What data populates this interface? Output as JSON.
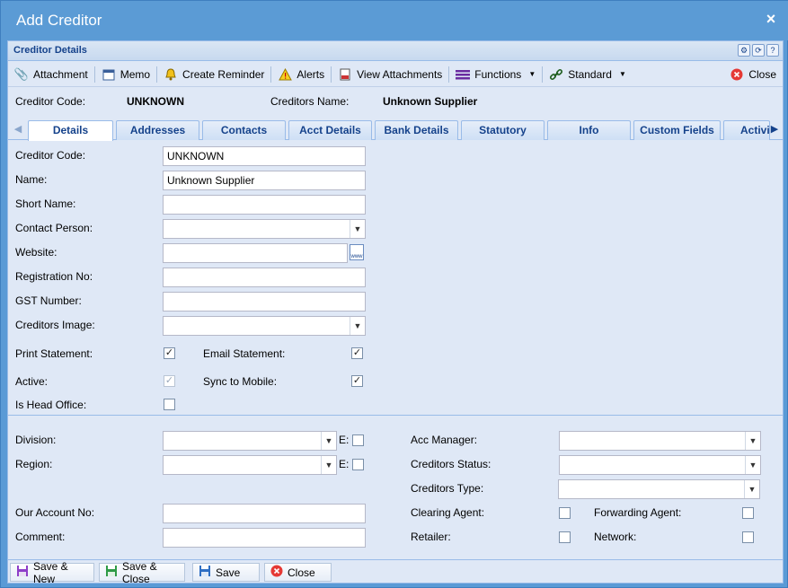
{
  "window": {
    "title": "Add Creditor",
    "close_glyph": "×"
  },
  "panel": {
    "title": "Creditor Details"
  },
  "toolbar": {
    "attachment": "Attachment",
    "memo": "Memo",
    "create_reminder": "Create Reminder",
    "alerts": "Alerts",
    "view_attachments": "View Attachments",
    "functions": "Functions",
    "standard": "Standard",
    "close": "Close"
  },
  "header_info": {
    "code_label": "Creditor Code:",
    "code_value": "UNKNOWN",
    "name_label": "Creditors Name:",
    "name_value": "Unknown Supplier"
  },
  "tabs": [
    "Details",
    "Addresses",
    "Contacts",
    "Acct Details",
    "Bank Details",
    "Statutory",
    "Info",
    "Custom Fields",
    "Activi"
  ],
  "form": {
    "creditor_code": {
      "label": "Creditor Code:",
      "value": "UNKNOWN"
    },
    "name": {
      "label": "Name:",
      "value": "Unknown Supplier"
    },
    "short_name": {
      "label": "Short Name:",
      "value": ""
    },
    "contact_person": {
      "label": "Contact Person:",
      "value": ""
    },
    "website": {
      "label": "Website:",
      "value": ""
    },
    "registration_no": {
      "label": "Registration No:",
      "value": ""
    },
    "gst_number": {
      "label": "GST Number:",
      "value": ""
    },
    "creditors_image": {
      "label": "Creditors Image:",
      "value": ""
    },
    "print_statement": {
      "label": "Print Statement:",
      "checked": true
    },
    "email_statement": {
      "label": "Email Statement:",
      "checked": true
    },
    "active": {
      "label": "Active:",
      "checked": true,
      "disabled": true
    },
    "sync_to_mobile": {
      "label": "Sync to Mobile:",
      "checked": true
    },
    "is_head_office": {
      "label": "Is Head Office:",
      "checked": false
    },
    "division": {
      "label": "Division:",
      "value": "",
      "e_label": "E:"
    },
    "region": {
      "label": "Region:",
      "value": "",
      "e_label": "E:"
    },
    "acc_manager": {
      "label": "Acc Manager:",
      "value": ""
    },
    "creditors_status": {
      "label": "Creditors Status:",
      "value": ""
    },
    "creditors_type": {
      "label": "Creditors Type:",
      "value": ""
    },
    "our_account_no": {
      "label": "Our Account No:",
      "value": ""
    },
    "comment": {
      "label": "Comment:",
      "value": ""
    },
    "clearing_agent": {
      "label": "Clearing Agent:",
      "checked": false
    },
    "forwarding_agent": {
      "label": "Forwarding Agent:",
      "checked": false
    },
    "retailer": {
      "label": "Retailer:",
      "checked": false
    },
    "network": {
      "label": "Network:",
      "checked": false
    }
  },
  "footer": {
    "save_new": "Save & New",
    "save_close": "Save & Close",
    "save": "Save",
    "close": "Close"
  },
  "colors": {
    "title_bar": "#5b9bd5",
    "panel_bg": "#dfe8f6",
    "header_text": "#15428b"
  }
}
